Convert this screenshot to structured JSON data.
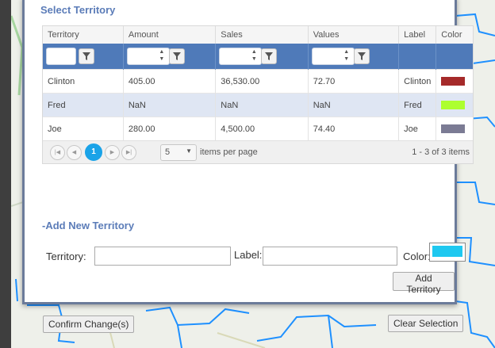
{
  "dialog": {
    "title": "Select Territory"
  },
  "grid": {
    "columns": [
      "Territory",
      "Amount",
      "Sales",
      "Values",
      "Label",
      "Color"
    ],
    "rows": [
      {
        "territory": "Clinton",
        "amount": "405.00",
        "sales": "36,530.00",
        "values": "72.70",
        "label": "Clinton",
        "color": "#a52a2a"
      },
      {
        "territory": "Fred",
        "amount": "NaN",
        "sales": "NaN",
        "values": "NaN",
        "label": "Fred",
        "color": "#adff2f"
      },
      {
        "territory": "Joe",
        "amount": "280.00",
        "sales": "4,500.00",
        "values": "74.40",
        "label": "Joe",
        "color": "#7b7b94"
      }
    ],
    "pager": {
      "current_page": "1",
      "page_size": "5",
      "items_per_page_label": "items per page",
      "info": "1 - 3 of 3 items"
    }
  },
  "add_section": {
    "title": "-Add New Territory",
    "territory_label": "Territory:",
    "territory_value": "",
    "label_label": "Label:",
    "label_value": "",
    "color_label": "Color:",
    "color_value": "#1ec8f0",
    "add_button": "Add Territory"
  },
  "footer": {
    "confirm_button": "Confirm Change(s)",
    "clear_button": "Clear Selection"
  },
  "colors": {
    "accent": "#5b7cb8",
    "filter_bar": "#4f7ab9",
    "alt_row": "#dfe6f3",
    "map_border": "#1e90ff",
    "active_page": "#1aa3e8"
  }
}
